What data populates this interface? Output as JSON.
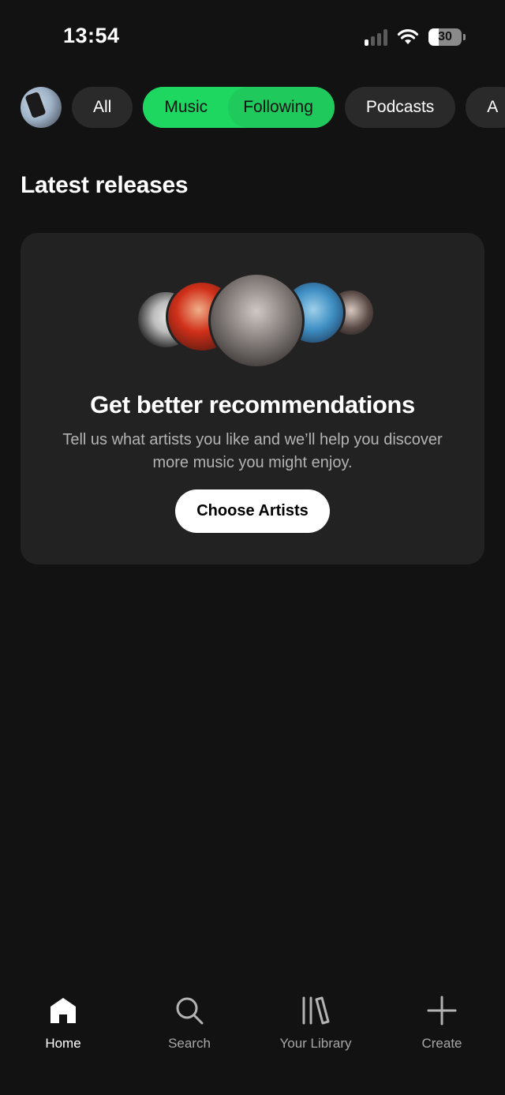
{
  "status_bar": {
    "time": "13:54",
    "battery": "30",
    "icons": [
      "cellular-signal-icon",
      "wifi-icon",
      "battery-icon"
    ]
  },
  "filters": {
    "avatar": "profile-avatar",
    "chips": [
      {
        "label": "All",
        "selected": false
      },
      {
        "label": "Music",
        "selected": true
      },
      {
        "label": "Following",
        "selected": true
      },
      {
        "label": "Podcasts",
        "selected": false
      },
      {
        "label": "A",
        "selected": false
      }
    ]
  },
  "section": {
    "title": "Latest releases"
  },
  "recommendation_card": {
    "title": "Get better recommendations",
    "description": "Tell us what artists you like and we’ll help you discover more music you might enjoy.",
    "button_label": "Choose Artists"
  },
  "bottom_nav": {
    "items": [
      {
        "label": "Home",
        "icon": "home-icon",
        "active": true
      },
      {
        "label": "Search",
        "icon": "search-icon",
        "active": false
      },
      {
        "label": "Your Library",
        "icon": "library-icon",
        "active": false
      },
      {
        "label": "Create",
        "icon": "plus-icon",
        "active": false
      }
    ]
  },
  "colors": {
    "background": "#121212",
    "accent": "#1ed760",
    "card": "#222222",
    "chip": "#2a2a2a"
  }
}
